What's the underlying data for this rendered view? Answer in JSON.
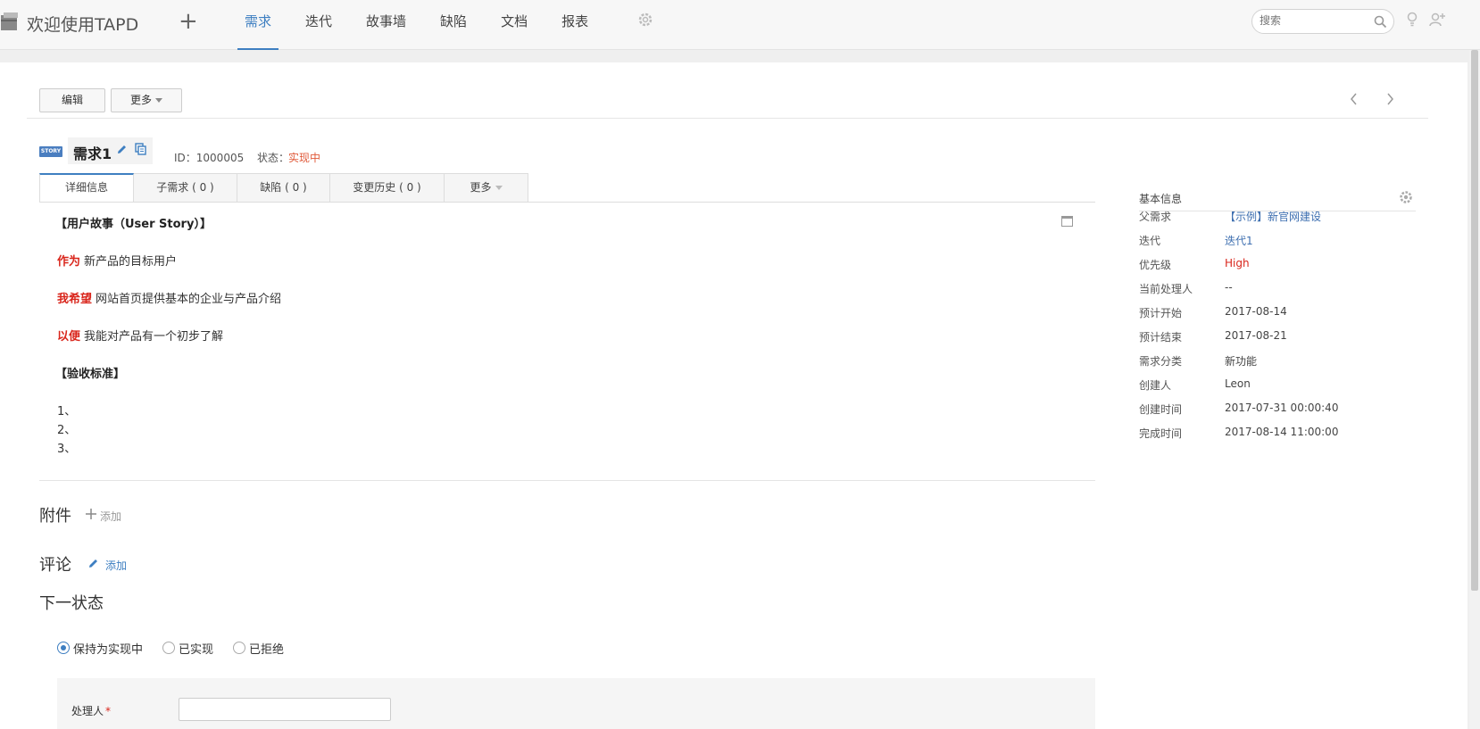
{
  "header": {
    "app_title": "欢迎使用TAPD",
    "plus_label": "+",
    "nav": [
      "需求",
      "迭代",
      "故事墙",
      "缺陷",
      "文档",
      "报表"
    ],
    "active_nav": "需求",
    "search_placeholder": "搜索"
  },
  "toolbar": {
    "edit_label": "编辑",
    "more_label": "更多"
  },
  "story": {
    "badge": "STORY",
    "title": "需求1",
    "id_text": "ID：1000005",
    "status_label": "状态：",
    "status_value": "实现中"
  },
  "tabs": [
    {
      "label": "详细信息"
    },
    {
      "label": "子需求 ( 0 )"
    },
    {
      "label": "缺陷 ( 0 )"
    },
    {
      "label": "变更历史 ( 0 )"
    },
    {
      "label": "更多"
    }
  ],
  "content": {
    "us_heading": "【用户故事（User Story）】",
    "as_keyword": "作为",
    "as_text": "新产品的目标用户",
    "want_keyword": "我希望",
    "want_text": "网站首页提供基本的企业与产品介绍",
    "so_keyword": "以便",
    "so_text": "我能对产品有一个初步了解",
    "acc_heading": "【验收标准】",
    "list": [
      "1、",
      "2、",
      "3、"
    ]
  },
  "sections": {
    "attachments_title": "附件",
    "attachments_add": "添加",
    "comments_title": "评论",
    "comments_add": "添加",
    "next_state_title": "下一状态"
  },
  "next_state": {
    "options": [
      "保持为实现中",
      "已实现",
      "已拒绝"
    ],
    "selected": "保持为实现中",
    "handler_label": "处理人",
    "required_mark": "*",
    "handler_value": ""
  },
  "info": {
    "title": "基本信息",
    "rows": [
      {
        "key": "父需求",
        "value": "【示例】新官网建设"
      },
      {
        "key": "迭代",
        "value": "迭代1"
      },
      {
        "key": "优先级",
        "value": "High"
      },
      {
        "key": "当前处理人",
        "value": "--"
      },
      {
        "key": "预计开始",
        "value": "2017-08-14"
      },
      {
        "key": "预计结束",
        "value": "2017-08-21"
      },
      {
        "key": "需求分类",
        "value": "新功能"
      },
      {
        "key": "创建人",
        "value": "Leon"
      },
      {
        "key": "创建时间",
        "value": "2017-07-31 00:00:40"
      },
      {
        "key": "完成时间",
        "value": "2017-08-14 11:00:00"
      }
    ]
  },
  "colors": {
    "accent": "#3e7fc1",
    "status": "#e05a3a",
    "keyword_red": "#d9261c"
  },
  "icons": [
    "app-logo-icon",
    "plus-icon",
    "gear-icon",
    "search-icon",
    "bulb-icon",
    "add-user-icon",
    "chevron-left-icon",
    "chevron-right-icon",
    "pencil-icon",
    "copy-icon",
    "expand-icon",
    "plus-icon"
  ]
}
